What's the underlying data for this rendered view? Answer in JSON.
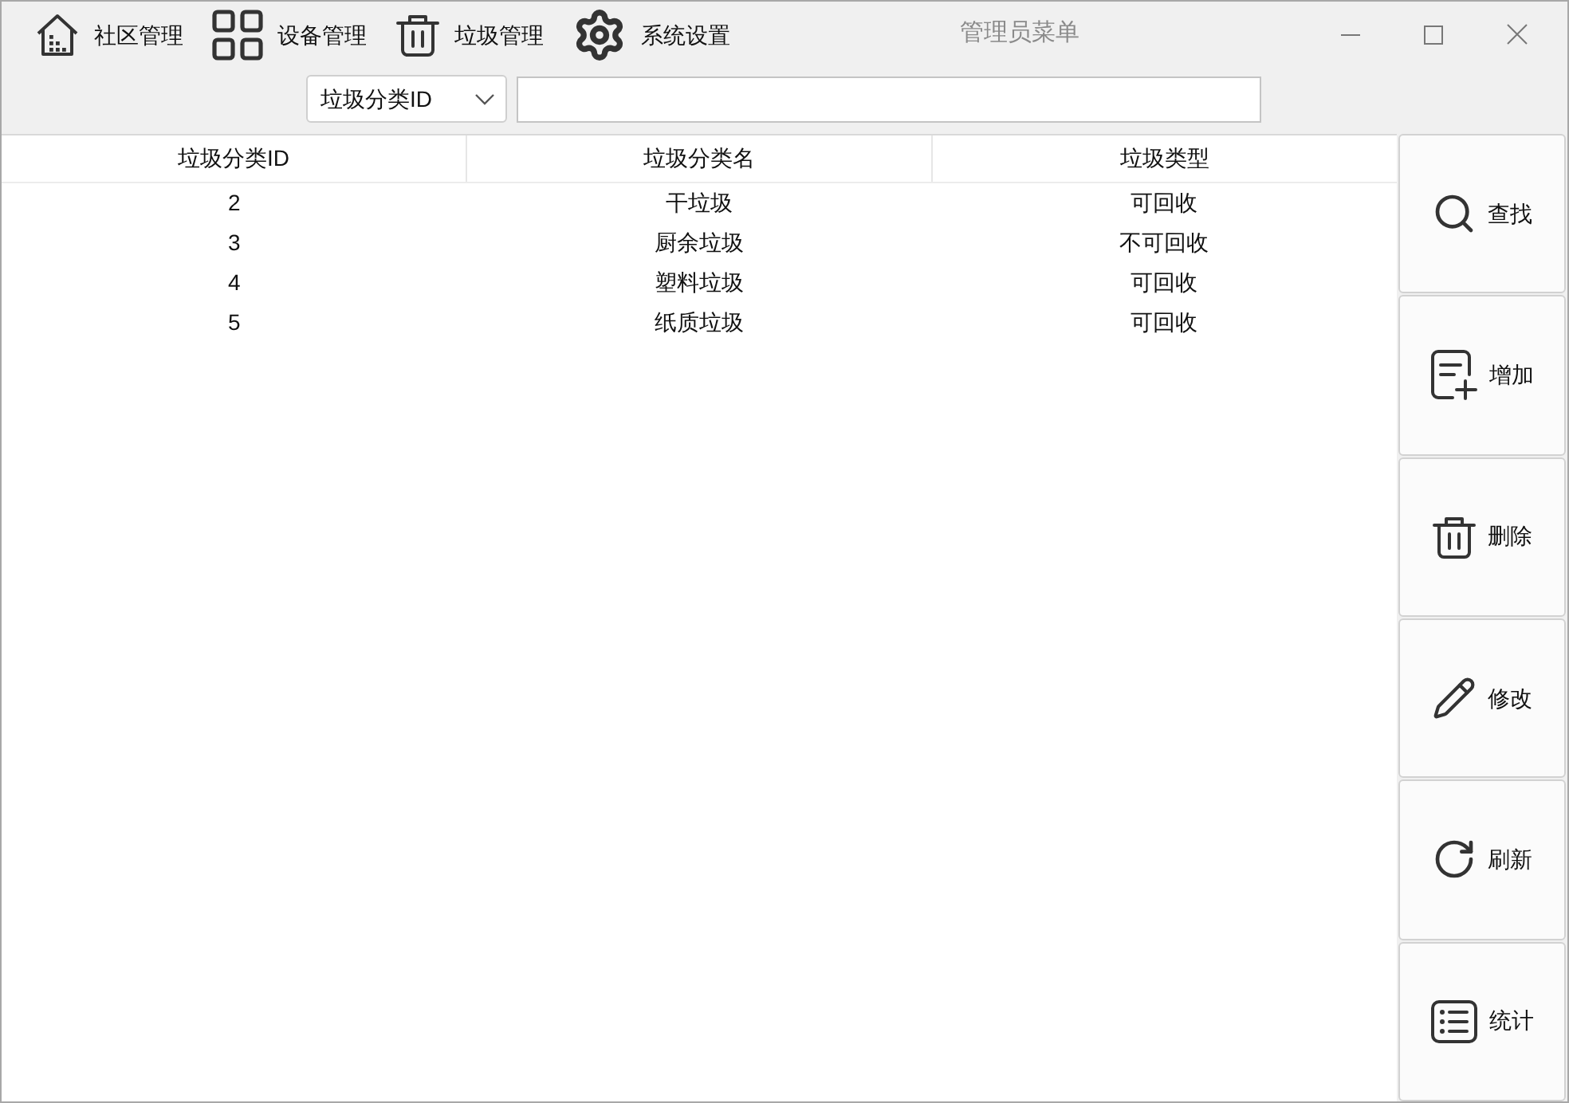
{
  "window": {
    "title": "管理员菜单"
  },
  "menu": [
    "社区管理",
    "设备管理",
    "垃圾管理",
    "系统设置"
  ],
  "search": {
    "filter": "垃圾分类ID"
  },
  "table": {
    "columns": [
      "垃圾分类ID",
      "垃圾分类名",
      "垃圾类型"
    ],
    "rows": [
      [
        "2",
        "干垃圾",
        "可回收"
      ],
      [
        "3",
        "厨余垃圾",
        "不可回收"
      ],
      [
        "4",
        "塑料垃圾",
        "可回收"
      ],
      [
        "5",
        "纸质垃圾",
        "可回收"
      ]
    ]
  },
  "actions": [
    "查找",
    "增加",
    "删除",
    "修改",
    "刷新",
    "统计"
  ]
}
